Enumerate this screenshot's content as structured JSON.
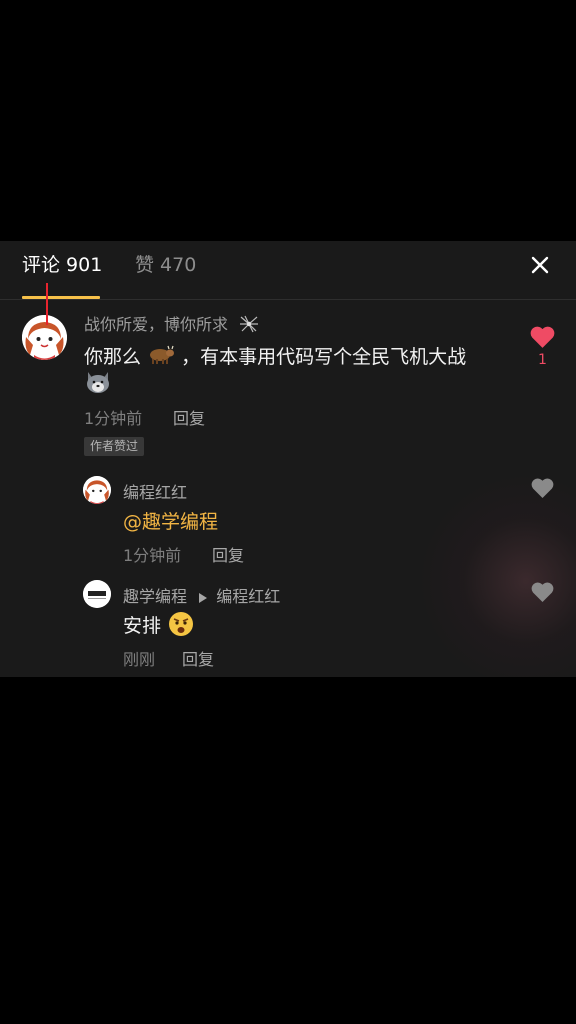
{
  "tabs": {
    "comments_label": "评论 901",
    "likes_label": "赞 470"
  },
  "colors": {
    "accent_underline": "#f7c14a",
    "mention": "#f2b544",
    "like_active": "#ef4b64",
    "like_inactive": "#8a8a8a",
    "panel_bg": "#1a1a1a"
  },
  "comment": {
    "author": "战你所爱，博你所求",
    "author_icon": "spider-icon",
    "text": "你那么",
    "text_emoji": "cow-emoji",
    "text_rest": "，有本事用代码写个全民飞机大战",
    "text_line2_emoji": "dog-emoji",
    "time": "1分钟前",
    "reply_label": "回复",
    "badge": "作者赞过",
    "like_count": "1",
    "liked": true
  },
  "replies": [
    {
      "author": "编程红红",
      "mention": "@趣学编程",
      "time": "1分钟前",
      "reply_label": "回复",
      "liked": false
    },
    {
      "author": "趣学编程",
      "reply_to": "编程红红",
      "text": "安排",
      "text_emoji": "shocked-face-emoji",
      "time": "刚刚",
      "reply_label": "回复",
      "liked": false
    }
  ]
}
